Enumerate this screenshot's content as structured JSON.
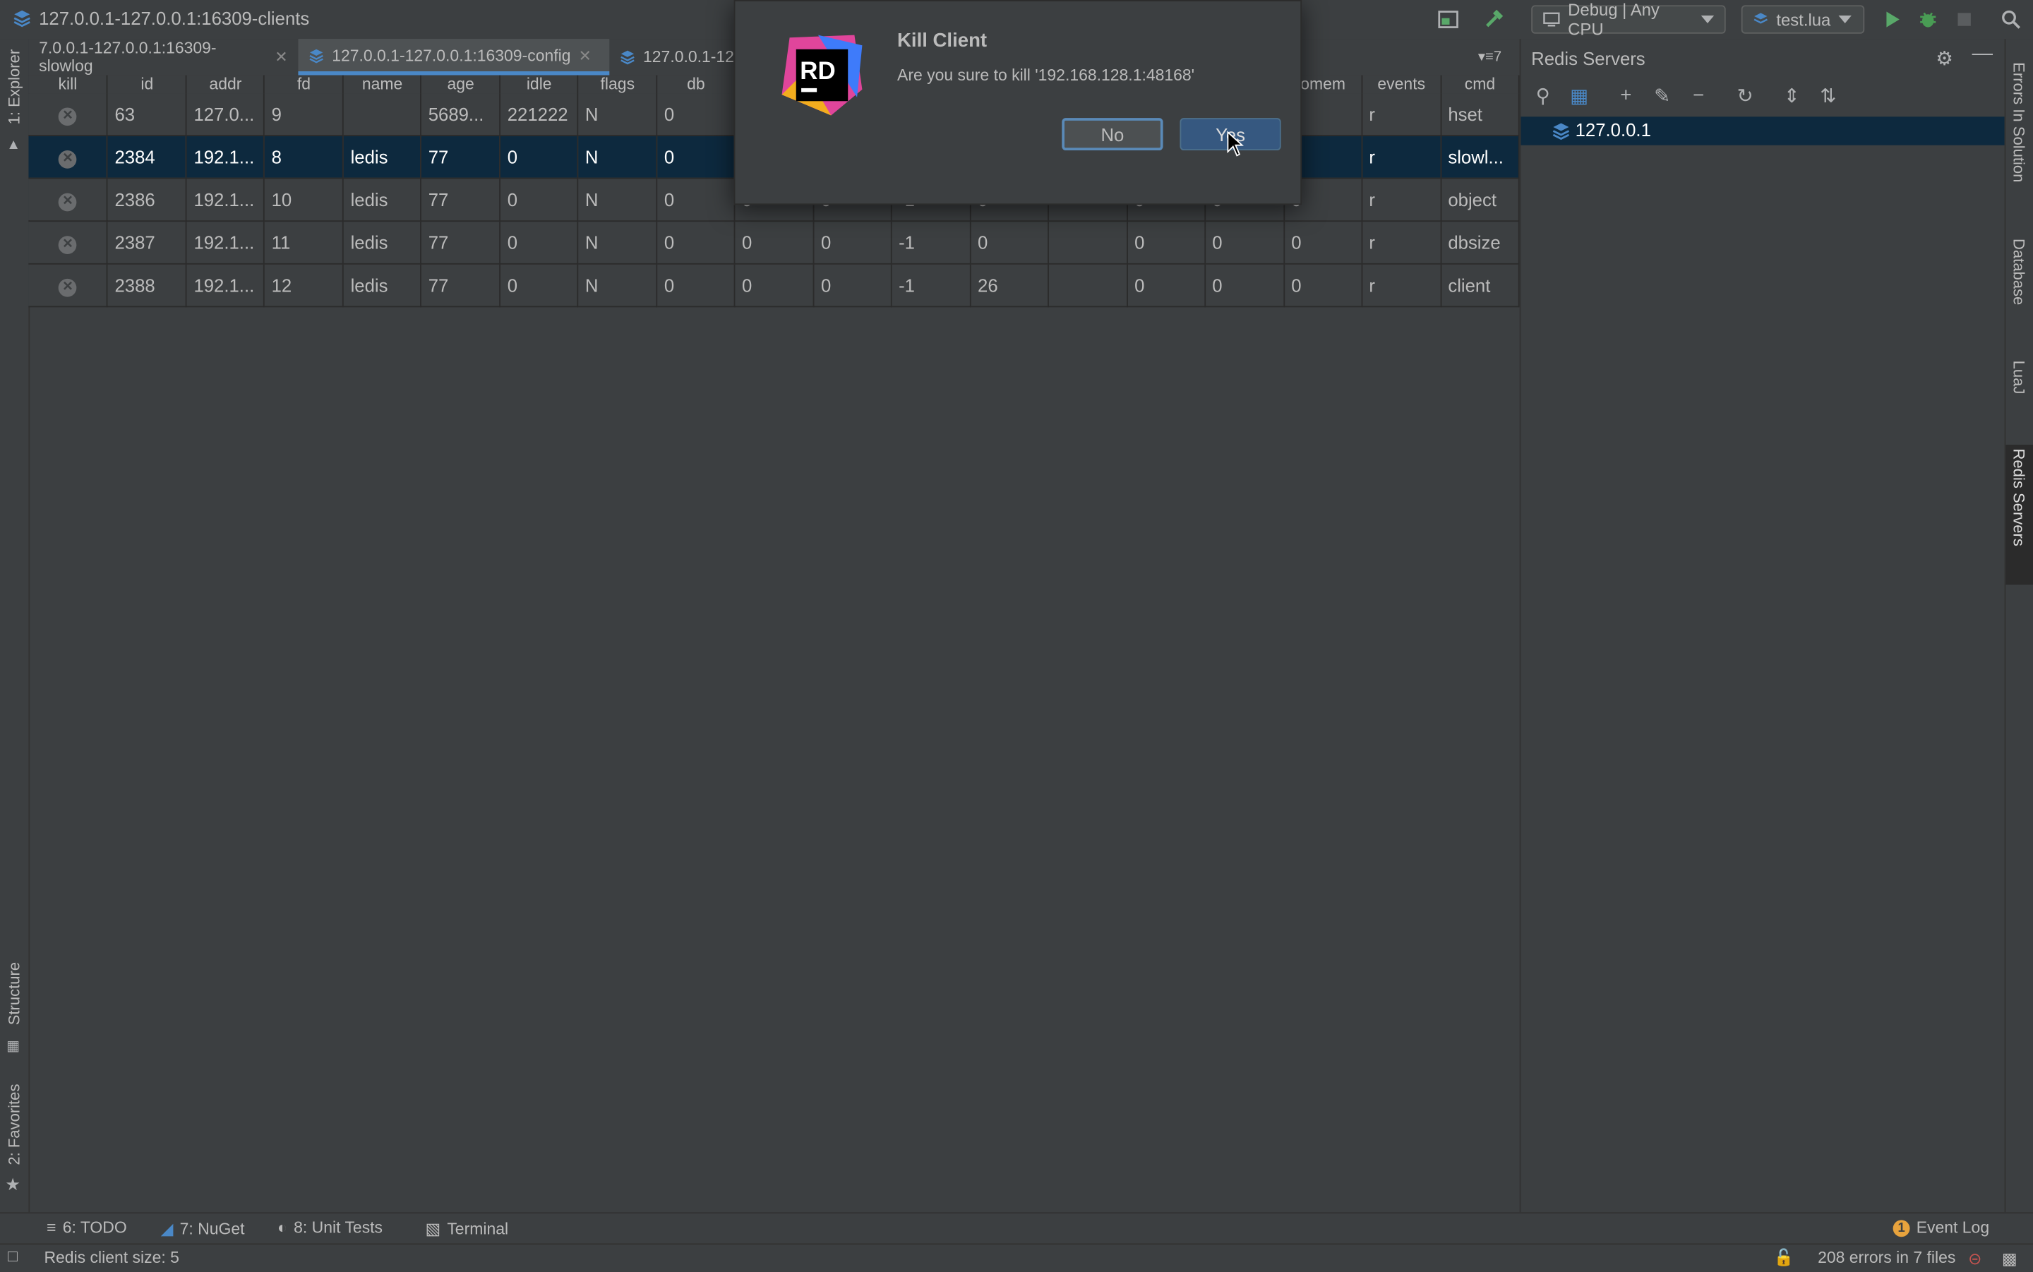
{
  "window": {
    "title": "127.0.0.1-127.0.0.1:16309-clients"
  },
  "toolbar": {
    "config_combo": "Debug | Any CPU",
    "run_combo": "test.lua"
  },
  "tabs": [
    {
      "label": "7.0.0.1-127.0.0.1:16309-slowlog"
    },
    {
      "label": "127.0.0.1-127.0.0.1:16309-config"
    },
    {
      "label": "127.0.0.1-12"
    }
  ],
  "tabs_overflow": "7",
  "left_stripe": {
    "explorer": "1: Explorer",
    "structure": "Structure",
    "favorites": "2: Favorites"
  },
  "right_stripe": {
    "errors": "Errors In Solution",
    "database": "Database",
    "lua": "LuaJ",
    "redis": "Redis Servers"
  },
  "table": {
    "columns": [
      "kill",
      "id",
      "addr",
      "fd",
      "name",
      "age",
      "idle",
      "flags",
      "db",
      "",
      "",
      "",
      "",
      "",
      "",
      "",
      "omem",
      "events",
      "cmd"
    ],
    "rows": [
      [
        "63",
        "127.0...",
        "9",
        "",
        "5689...",
        "221222",
        "N",
        "0",
        "0",
        "0",
        "-1",
        "0",
        "",
        "0",
        "0",
        "0",
        "r",
        "hset"
      ],
      [
        "2384",
        "192.1...",
        "8",
        "ledis",
        "77",
        "0",
        "N",
        "0",
        "0",
        "0",
        "-1",
        "0",
        "",
        "0",
        "0",
        "0",
        "r",
        "slowl..."
      ],
      [
        "2386",
        "192.1...",
        "10",
        "ledis",
        "77",
        "0",
        "N",
        "0",
        "0",
        "0",
        "-1",
        "0",
        "",
        "0",
        "0",
        "0",
        "r",
        "object"
      ],
      [
        "2387",
        "192.1...",
        "11",
        "ledis",
        "77",
        "0",
        "N",
        "0",
        "0",
        "0",
        "-1",
        "0",
        "",
        "0",
        "0",
        "0",
        "r",
        "dbsize"
      ],
      [
        "2388",
        "192.1...",
        "12",
        "ledis",
        "77",
        "0",
        "N",
        "0",
        "0",
        "0",
        "-1",
        "26",
        "",
        "0",
        "0",
        "0",
        "r",
        "client"
      ]
    ]
  },
  "redis_panel": {
    "title": "Redis Servers",
    "server": "127.0.0.1"
  },
  "dialog": {
    "logo": "RD",
    "title": "Kill Client",
    "message": "Are you sure to kill '192.168.128.1:48168'",
    "no": "No",
    "yes": "Yes"
  },
  "toolwindows": {
    "todo": "6: TODO",
    "nuget": "7: NuGet",
    "unittests": "8: Unit Tests",
    "terminal": "Terminal",
    "eventlog": "Event Log",
    "eventlog_count": "1"
  },
  "status": {
    "left": "Redis client size: 5",
    "errors": "208 errors in 7 files"
  },
  "colors": {
    "selection": "#0d293e",
    "accent": "#4a88c7",
    "run": "#59a869",
    "debug": "#499c54"
  }
}
